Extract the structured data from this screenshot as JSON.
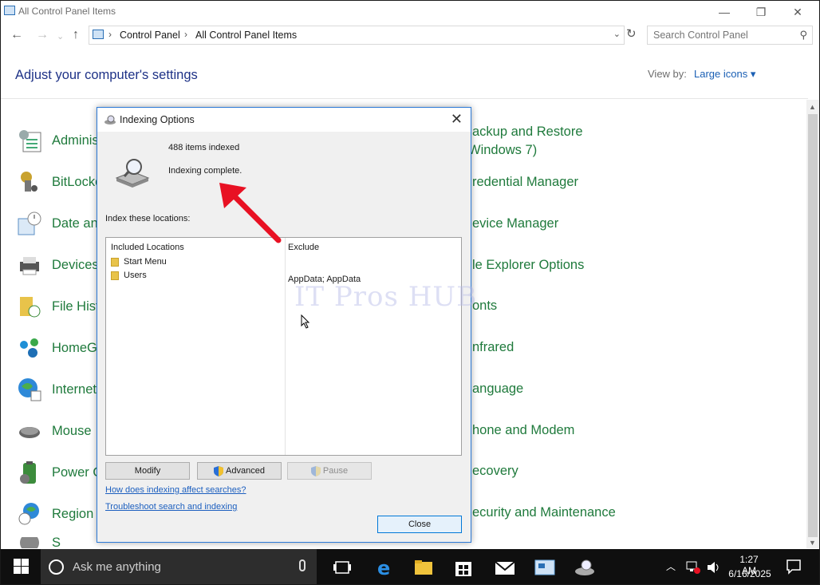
{
  "window": {
    "title": "All Control Panel Items",
    "minimize": "—",
    "restore": "❐",
    "close": "✕"
  },
  "address": {
    "crumbs": [
      "Control Panel",
      "All Control Panel Items"
    ],
    "search_placeholder": "Search Control Panel"
  },
  "main": {
    "heading": "Adjust your computer's settings",
    "view_by_label": "View by:",
    "view_by_value": "Large icons ▾",
    "left_items": [
      "Adminis",
      "BitLocke",
      "Date an",
      "Devices",
      "File Hist",
      "HomeG",
      "Internet",
      "Mouse",
      "Power O",
      "Region",
      "S"
    ],
    "right_items": [
      "ackup and Restore",
      "Windows 7)",
      "redential Manager",
      "evice Manager",
      "le Explorer Options",
      "onts",
      "nfrared",
      "anguage",
      "hone and Modem",
      "ecovery",
      "ecurity and Maintenance"
    ]
  },
  "dialog": {
    "title": "Indexing Options",
    "items_indexed": "488 items indexed",
    "status": "Indexing complete.",
    "index_locations_label": "Index these locations:",
    "col_included": "Included Locations",
    "col_exclude": "Exclude",
    "locations": [
      "Start Menu",
      "Users"
    ],
    "exclusions": "AppData; AppData",
    "watermark": "IT Pros HUB",
    "buttons": {
      "modify": "Modify",
      "advanced": "Advanced",
      "pause": "Pause",
      "close": "Close"
    },
    "links": {
      "how": "How does indexing affect searches?",
      "troubleshoot": "Troubleshoot search and indexing"
    }
  },
  "taskbar": {
    "search_text": "Ask me anything",
    "time": "1:27 AM",
    "date": "6/16/2025"
  },
  "colors": {
    "accent": "#0078d7",
    "item_green": "#1f7a3c",
    "heading_blue": "#1e3287",
    "link_blue": "#1c5fbf",
    "arrow_red": "#e81123"
  }
}
